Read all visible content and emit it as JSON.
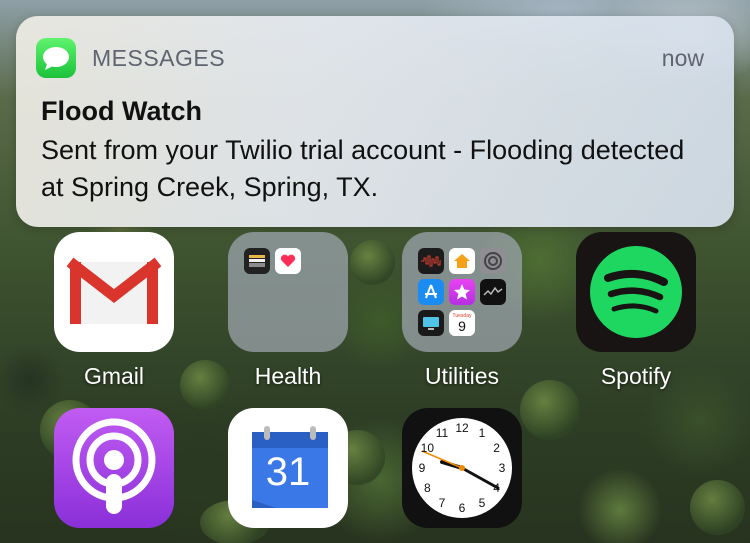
{
  "notification": {
    "app_name": "MESSAGES",
    "time": "now",
    "title": "Flood Watch",
    "body": "Sent from your Twilio trial account - Flooding detected at Spring Creek, Spring, TX."
  },
  "apps": {
    "gmail": {
      "label": "Gmail"
    },
    "health": {
      "label": "Health"
    },
    "utilities": {
      "label": "Utilities",
      "calendar_day": "Tuesday",
      "calendar_date": "9"
    },
    "spotify": {
      "label": "Spotify"
    },
    "calendar": {
      "date": "31"
    },
    "clock": {
      "numerals": [
        "12",
        "1",
        "2",
        "3",
        "4",
        "5",
        "6",
        "7",
        "8",
        "9",
        "10",
        "11"
      ]
    }
  },
  "colors": {
    "messages_green": "#1bc23a",
    "gmail_red": "#d9352c",
    "spotify_green": "#1ed760",
    "podcasts_purple": "#9a3ee6",
    "calendar_blue": "#3b78e7"
  }
}
